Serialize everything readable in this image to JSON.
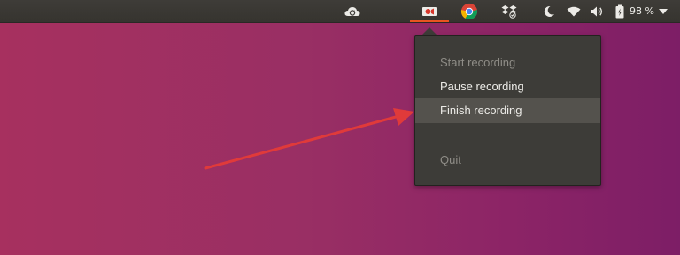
{
  "tray": {
    "icons": {
      "cloud": "cloud-sync-icon",
      "recorder": "video-camera-icon",
      "chrome": "chrome-icon",
      "dropbox": "dropbox-icon",
      "night": "moon-icon",
      "wifi": "wifi-icon",
      "volume": "volume-icon",
      "battery": "battery-icon"
    },
    "battery_label": "98 %",
    "dropdown": "chevron-down-icon"
  },
  "menu": {
    "items": [
      {
        "label": "Start recording",
        "state": "disabled"
      },
      {
        "label": "Pause recording",
        "state": "enabled"
      },
      {
        "label": "Finish recording",
        "state": "highlighted"
      },
      {
        "label": "Quit",
        "state": "disabled"
      }
    ]
  },
  "colors": {
    "desktop_left": "#a7305f",
    "desktop_right": "#7d1e66",
    "panel": "#3e3c38",
    "accent": "#e95420",
    "annotation_arrow": "#e03a3a"
  }
}
